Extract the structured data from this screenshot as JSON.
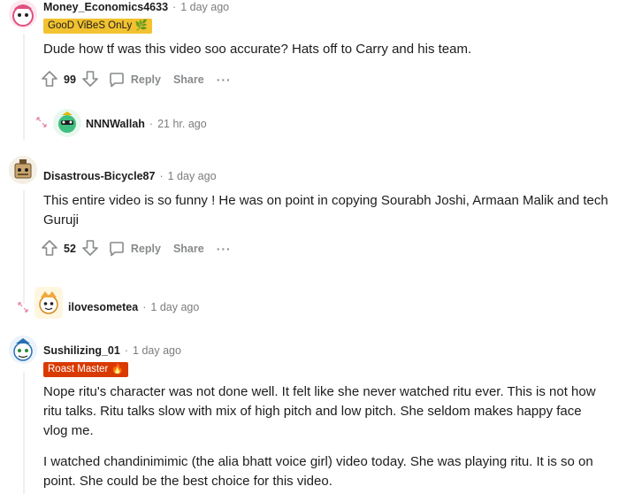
{
  "comments": [
    {
      "username": "Money_Economics4633",
      "time": "1 day ago",
      "flair": "GooD ViBeS OnLy 🌿",
      "body": [
        "Dude how tf was this video soo accurate? Hats off to Carry and his team."
      ],
      "votes": "99",
      "reply_label": "Reply",
      "share_label": "Share",
      "more": "···"
    },
    {
      "username": "NNNWallah",
      "time": "21 hr. ago",
      "collapsed": true
    },
    {
      "username": "Disastrous-Bicycle87",
      "time": "1 day ago",
      "body": [
        "This entire video is so funny ! He was on point in copying Sourabh Joshi, Armaan Malik and tech Guruji"
      ],
      "votes": "52",
      "reply_label": "Reply",
      "share_label": "Share",
      "more": "···"
    },
    {
      "username": "ilovesometea",
      "time": "1 day ago",
      "collapsed": true
    },
    {
      "username": "Sushilizing_01",
      "time": "1 day ago",
      "flair": "Roast Master 🔥",
      "body": [
        "Nope ritu's character was not done well. It felt like she never watched ritu ever. This is not how ritu talks. Ritu talks slow with mix of high pitch and low pitch. She seldom makes happy face vlog me.",
        "I watched chandinimimic (the alia bhatt voice girl) video today. She was playing ritu. It is so on point. She could be the best choice for this video."
      ]
    }
  ],
  "colors": {
    "flair_yellow": "#f2c230",
    "flair_red": "#d93a00",
    "meta_gray": "#7c7c7c",
    "action_gray": "#878a8c",
    "expand_pink": "#e87fa0"
  }
}
